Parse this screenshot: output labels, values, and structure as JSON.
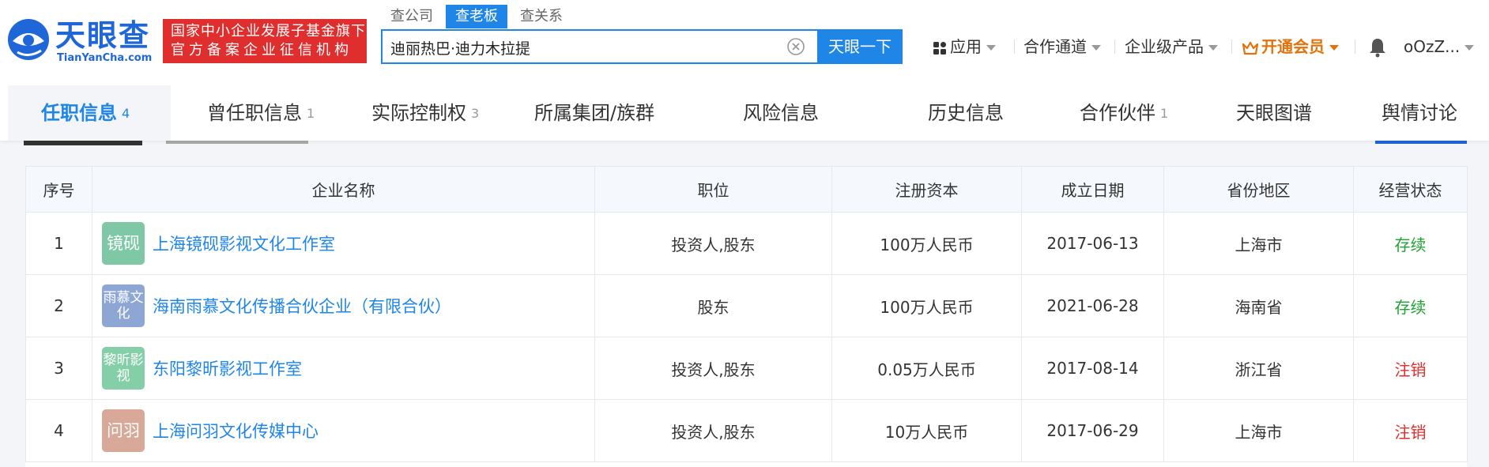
{
  "header": {
    "logo_name": "天眼查",
    "logo_domain": "TianYanCha.com",
    "banner_line1": "国家中小企业发展子基金旗下",
    "banner_line2": "官方备案企业征信机构",
    "search_tabs": [
      "查公司",
      "查老板",
      "查关系"
    ],
    "search_value": "迪丽热巴·迪力木拉提",
    "search_button": "天眼一下",
    "nav": {
      "apps": "应用",
      "cooperation": "合作通道",
      "enterprise": "企业级产品",
      "vip": "开通会员",
      "user": "oOzZ..."
    }
  },
  "tabs": [
    {
      "label": "任职信息",
      "count": "4"
    },
    {
      "label": "曾任职信息",
      "count": "1"
    },
    {
      "label": "实际控制权",
      "count": "3"
    },
    {
      "label": "所属集团/族群",
      "count": ""
    },
    {
      "label": "风险信息",
      "count": ""
    },
    {
      "label": "历史信息",
      "count": ""
    },
    {
      "label": "合作伙伴",
      "count": "1"
    },
    {
      "label": "天眼图谱",
      "count": ""
    },
    {
      "label": "舆情讨论",
      "count": ""
    }
  ],
  "table": {
    "headers": [
      "序号",
      "企业名称",
      "职位",
      "注册资本",
      "成立日期",
      "省份地区",
      "经营状态"
    ],
    "rows": [
      {
        "index": "1",
        "logo_text": "镜砚",
        "logo_color": "#7ec8a6",
        "name": "上海镜砚影视文化工作室",
        "position": "投资人,股东",
        "capital": "100万人民币",
        "date": "2017-06-13",
        "region": "上海市",
        "status": "存续",
        "status_color": "#1fa233"
      },
      {
        "index": "2",
        "logo_text": "雨慕文化",
        "logo_color": "#8ea6d4",
        "name": "海南雨慕文化传播合伙企业（有限合伙）",
        "position": "股东",
        "capital": "100万人民币",
        "date": "2021-06-28",
        "region": "海南省",
        "status": "存续",
        "status_color": "#1fa233"
      },
      {
        "index": "3",
        "logo_text": "黎昕影视",
        "logo_color": "#84cfa8",
        "name": "东阳黎昕影视工作室",
        "position": "投资人,股东",
        "capital": "0.05万人民币",
        "date": "2017-08-14",
        "region": "浙江省",
        "status": "注销",
        "status_color": "#e02d2d"
      },
      {
        "index": "4",
        "logo_text": "问羽",
        "logo_color": "#d8a898",
        "name": "上海问羽文化传媒中心",
        "position": "投资人,股东",
        "capital": "10万人民币",
        "date": "2017-06-29",
        "region": "上海市",
        "status": "注销",
        "status_color": "#e02d2d"
      }
    ]
  }
}
